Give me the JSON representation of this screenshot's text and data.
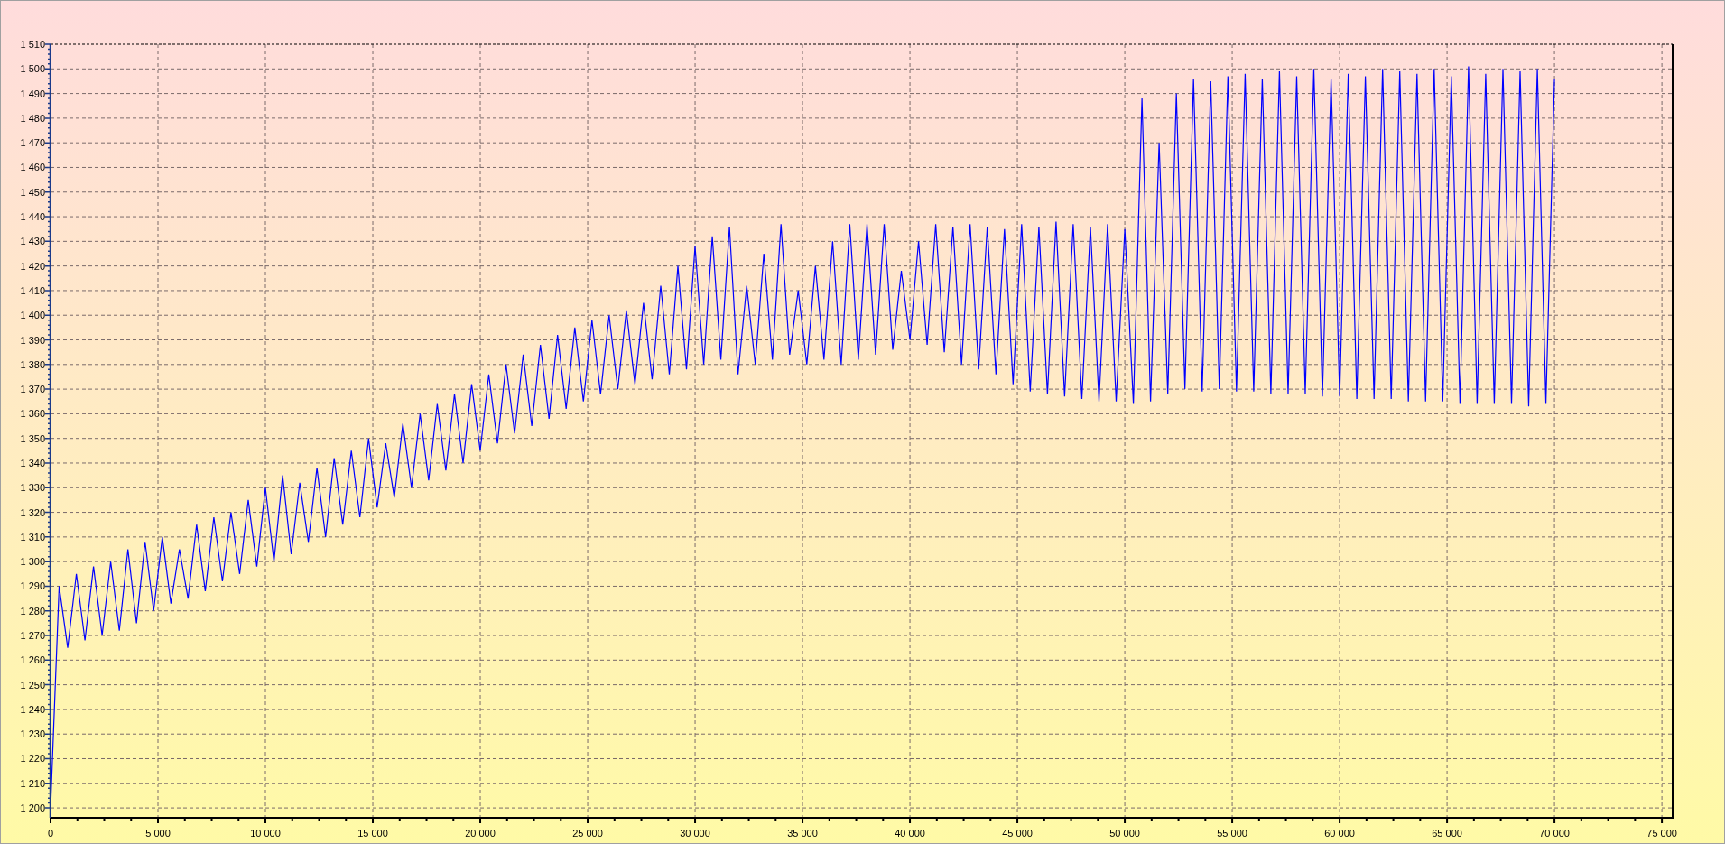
{
  "chart": {
    "chart_data": {
      "type": "line",
      "grid": true,
      "xlim": [
        0,
        75500
      ],
      "ylim": [
        1196,
        1510
      ],
      "yticks": [
        {
          "value": 1510,
          "label": "1 510"
        },
        {
          "value": 1500,
          "label": "1 500"
        },
        {
          "value": 1490,
          "label": "1 490"
        },
        {
          "value": 1480,
          "label": "1 480"
        },
        {
          "value": 1470,
          "label": "1 470"
        },
        {
          "value": 1460,
          "label": "1 460"
        },
        {
          "value": 1450,
          "label": "1 450"
        },
        {
          "value": 1440,
          "label": "1 440"
        },
        {
          "value": 1430,
          "label": "1 430"
        },
        {
          "value": 1420,
          "label": "1 420"
        },
        {
          "value": 1410,
          "label": "1 410"
        },
        {
          "value": 1400,
          "label": "1 400"
        },
        {
          "value": 1390,
          "label": "1 390"
        },
        {
          "value": 1380,
          "label": "1 380"
        },
        {
          "value": 1370,
          "label": "1 370"
        },
        {
          "value": 1360,
          "label": "1 360"
        },
        {
          "value": 1350,
          "label": "1 350"
        },
        {
          "value": 1340,
          "label": "1 340"
        },
        {
          "value": 1330,
          "label": "1 330"
        },
        {
          "value": 1320,
          "label": "1 320"
        },
        {
          "value": 1310,
          "label": "1 310"
        },
        {
          "value": 1300,
          "label": "1 300"
        },
        {
          "value": 1290,
          "label": "1 290"
        },
        {
          "value": 1280,
          "label": "1 280"
        },
        {
          "value": 1270,
          "label": "1 270"
        },
        {
          "value": 1260,
          "label": "1 260"
        },
        {
          "value": 1250,
          "label": "1 250"
        },
        {
          "value": 1240,
          "label": "1 240"
        },
        {
          "value": 1230,
          "label": "1 230"
        },
        {
          "value": 1220,
          "label": "1 220"
        },
        {
          "value": 1210,
          "label": "1 210"
        },
        {
          "value": 1200,
          "label": "1 200"
        }
      ],
      "xticks": [
        {
          "value": 0,
          "label": "0"
        },
        {
          "value": 5000,
          "label": "5 000"
        },
        {
          "value": 10000,
          "label": "10 000"
        },
        {
          "value": 15000,
          "label": "15 000"
        },
        {
          "value": 20000,
          "label": "20 000"
        },
        {
          "value": 25000,
          "label": "25 000"
        },
        {
          "value": 30000,
          "label": "30 000"
        },
        {
          "value": 35000,
          "label": "35 000"
        },
        {
          "value": 40000,
          "label": "40 000"
        },
        {
          "value": 45000,
          "label": "45 000"
        },
        {
          "value": 50000,
          "label": "50 000"
        },
        {
          "value": 55000,
          "label": "55 000"
        },
        {
          "value": 60000,
          "label": "60 000"
        },
        {
          "value": 65000,
          "label": "65 000"
        },
        {
          "value": 70000,
          "label": "70 000"
        },
        {
          "value": 75000,
          "label": "75 000"
        }
      ],
      "x": [
        0,
        400,
        800,
        1200,
        1600,
        2000,
        2400,
        2800,
        3200,
        3600,
        4000,
        4400,
        4800,
        5200,
        5600,
        6000,
        6400,
        6800,
        7200,
        7600,
        8000,
        8400,
        8800,
        9200,
        9600,
        10000,
        10400,
        10800,
        11200,
        11600,
        12000,
        12400,
        12800,
        13200,
        13600,
        14000,
        14400,
        14800,
        15200,
        15600,
        16000,
        16400,
        16800,
        17200,
        17600,
        18000,
        18400,
        18800,
        19200,
        19600,
        20000,
        20400,
        20800,
        21200,
        21600,
        22000,
        22400,
        22800,
        23200,
        23600,
        24000,
        24400,
        24800,
        25200,
        25600,
        26000,
        26400,
        26800,
        27200,
        27600,
        28000,
        28400,
        28800,
        29200,
        29600,
        30000,
        30400,
        30800,
        31200,
        31600,
        32000,
        32400,
        32800,
        33200,
        33600,
        34000,
        34400,
        34800,
        35200,
        35600,
        36000,
        36400,
        36800,
        37200,
        37600,
        38000,
        38400,
        38800,
        39200,
        39600,
        40000,
        40400,
        40800,
        41200,
        41600,
        42000,
        42400,
        42800,
        43200,
        43600,
        44000,
        44400,
        44800,
        45200,
        45600,
        46000,
        46400,
        46800,
        47200,
        47600,
        48000,
        48400,
        48800,
        49200,
        49600,
        50000,
        50400,
        50800,
        51200,
        51600,
        52000,
        52400,
        52800,
        53200,
        53600,
        54000,
        54400,
        54800,
        55200,
        55600,
        56000,
        56400,
        56800,
        57200,
        57600,
        58000,
        58400,
        58800,
        59200,
        59600,
        60000,
        60400,
        60800,
        61200,
        61600,
        62000,
        62400,
        62800,
        63200,
        63600,
        64000,
        64400,
        64800,
        65200,
        65600,
        66000,
        66400,
        66800,
        67200,
        67600,
        68000,
        68400,
        68800,
        69200,
        69600,
        70000
      ],
      "series": [
        {
          "color": "#0000ff",
          "values": [
            1200,
            1290,
            1265,
            1295,
            1268,
            1298,
            1270,
            1300,
            1272,
            1305,
            1275,
            1308,
            1280,
            1310,
            1283,
            1305,
            1285,
            1315,
            1288,
            1318,
            1292,
            1320,
            1295,
            1325,
            1298,
            1330,
            1300,
            1335,
            1303,
            1332,
            1308,
            1338,
            1310,
            1342,
            1315,
            1345,
            1318,
            1350,
            1322,
            1348,
            1326,
            1356,
            1330,
            1360,
            1333,
            1364,
            1337,
            1368,
            1340,
            1372,
            1345,
            1376,
            1348,
            1380,
            1352,
            1384,
            1355,
            1388,
            1358,
            1392,
            1362,
            1395,
            1365,
            1398,
            1368,
            1400,
            1370,
            1402,
            1372,
            1405,
            1374,
            1412,
            1376,
            1420,
            1378,
            1428,
            1380,
            1432,
            1382,
            1436,
            1376,
            1412,
            1380,
            1425,
            1382,
            1437,
            1384,
            1410,
            1380,
            1420,
            1382,
            1430,
            1380,
            1437,
            1382,
            1437,
            1384,
            1437,
            1386,
            1418,
            1390,
            1430,
            1388,
            1437,
            1385,
            1436,
            1380,
            1437,
            1378,
            1436,
            1376,
            1435,
            1372,
            1437,
            1369,
            1436,
            1368,
            1438,
            1367,
            1437,
            1366,
            1436,
            1365,
            1437,
            1365,
            1435,
            1364,
            1488,
            1365,
            1470,
            1368,
            1490,
            1370,
            1496,
            1369,
            1495,
            1370,
            1497,
            1369,
            1498,
            1369,
            1496,
            1368,
            1499,
            1368,
            1497,
            1368,
            1500,
            1367,
            1496,
            1367,
            1498,
            1366,
            1497,
            1366,
            1500,
            1366,
            1499,
            1365,
            1498,
            1365,
            1500,
            1365,
            1497,
            1364,
            1501,
            1364,
            1498,
            1364,
            1500,
            1364,
            1499,
            1363,
            1500,
            1364,
            1496
          ]
        }
      ]
    }
  }
}
